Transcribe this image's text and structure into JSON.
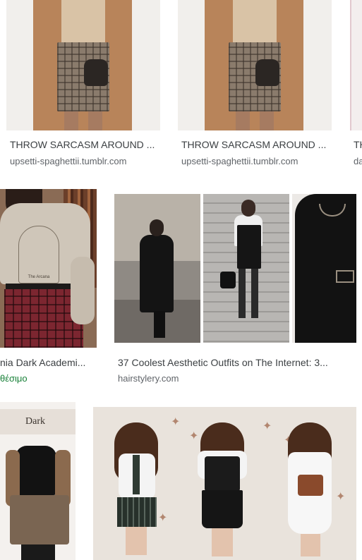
{
  "results": [
    {
      "title": "THROW SARCASM AROUND ...",
      "source": "upsetti-spaghettii.tumblr.com"
    },
    {
      "title": "THROW SARCASM AROUND ...",
      "source": "upsetti-spaghettii.tumblr.com"
    },
    {
      "title": "TH",
      "source": "da"
    },
    {
      "title": "nia Dark Academi...",
      "source": "θέσιμο"
    },
    {
      "title": "37 Coolest Aesthetic Outfits on The Internet: 3...",
      "source": "hairstylery.com"
    }
  ],
  "overlay_texts": {
    "sweatshirt_print": "The Arcana",
    "dark_label": "Dark"
  },
  "colors": {
    "title": "#3c4043",
    "source": "#5f6368",
    "source_green": "#188038"
  }
}
